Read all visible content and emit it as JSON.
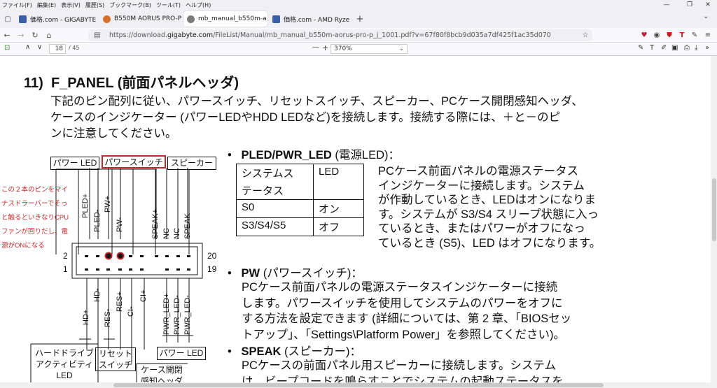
{
  "menu": {
    "items": [
      "ファイル(F)",
      "編集(E)",
      "表示(V)",
      "履歴(S)",
      "ブックマーク(B)",
      "ツール(T)",
      "ヘルプ(H)"
    ]
  },
  "window": {
    "minimize": "—",
    "restore": "❐",
    "close": "✕"
  },
  "tabs": [
    {
      "label": "価格.com - GIGABYTE",
      "color": "#3a5fa8"
    },
    {
      "label": "B550M AORUS PRO-P",
      "color": "#d8702a"
    },
    {
      "label": "mb_manual_b550m-a",
      "color": "#7a7a7a"
    },
    {
      "label": "価格.com - AMD Ryze",
      "color": "#3a5fa8"
    }
  ],
  "new_tab_label": "+",
  "url": {
    "prefix": "https://download.",
    "host": "gigabyte.com",
    "path": "/FileList/Manual/mb_manual_b550m-aorus-pro-p_j_1001.pdf?v=67f80f8bcb9d035a7df425f1ac35d070"
  },
  "pdf": {
    "page": "18",
    "total": "/ 45",
    "zoom": "370%",
    "minus": "—",
    "plus": "+"
  },
  "doc": {
    "heading_num": "11)",
    "heading": "F_PANEL (前面パネルヘッダ)",
    "intro": [
      "下記のピン配列に従い、パワースイッチ、リセットスイッチ、スピーカー、PCケース開閉感知ヘッダ、",
      "ケースのインジケーター (パワーLEDやHDD LEDなど)を接続します。接続する際には、＋と－のピ",
      "ンに注意してください。"
    ],
    "diagram": {
      "top_labels": [
        "パワー LED",
        "パワースイッチ",
        "スピーカー"
      ],
      "bottom_labels": [
        "ハードドライブ",
        "アクティビティ",
        "LED",
        "リセット",
        "スイッチ",
        "ケース開閉",
        "感知ヘッダ",
        "パワー LED"
      ],
      "top_pins": [
        "PLED+",
        "PLED-",
        "PW+",
        "PW-",
        "SPEAK+",
        "NC",
        "NC",
        "SPEAK-"
      ],
      "bottom_pins": [
        "HD+",
        "HD-",
        "RES-",
        "RES+",
        "CI-",
        "CI+",
        "PWR_LED+",
        "PWR_LED-",
        "PWR_LED-"
      ],
      "pin_numbers": [
        "2",
        "1",
        "20",
        "19"
      ],
      "note": [
        "この２本のピンをマイ",
        "ナスドラーバーでそっ",
        "と触るといきなりCPU",
        "ファンが回りだし、電",
        "源がONになる"
      ]
    },
    "pled": {
      "bullet": "•",
      "title": "PLED/PWR_LED",
      "title_suffix": " (電源LED)：",
      "table": [
        [
          "システムス",
          "LED"
        ],
        [
          "テータス",
          ""
        ],
        [
          "S0",
          "オン"
        ],
        [
          "S3/S4/S5",
          "オフ"
        ]
      ],
      "desc": [
        "PCケース前面パネルの電源ステータス",
        "インジケーターに接続します。システム",
        "が作動しているとき、LEDはオンになりま",
        "す。システムが S3/S4 スリープ状態に入っ",
        "ているとき、またはパワーがオフになっ",
        "ているとき (S5)、LED はオフになります。"
      ]
    },
    "pw": {
      "title": "PW",
      "title_suffix": " (パワースイッチ)：",
      "desc": [
        "PCケース前面パネルの電源ステータスインジケーターに接続",
        "します。パワースイッチを使用してシステムのパワーをオフに",
        "する方法を設定できます (詳細については、第 2 章、「BIOSセッ",
        "トアップ」、「Settings\\Platform Power」を参照してください)。"
      ]
    },
    "speak": {
      "title": "SPEAK",
      "title_suffix": " (スピーカー)：",
      "desc": [
        "PCケースの前面パネル用スピーカーに接続します。システム",
        "は、ビープコードを鳴らすことでシステムの起動ステータスを"
      ]
    }
  }
}
